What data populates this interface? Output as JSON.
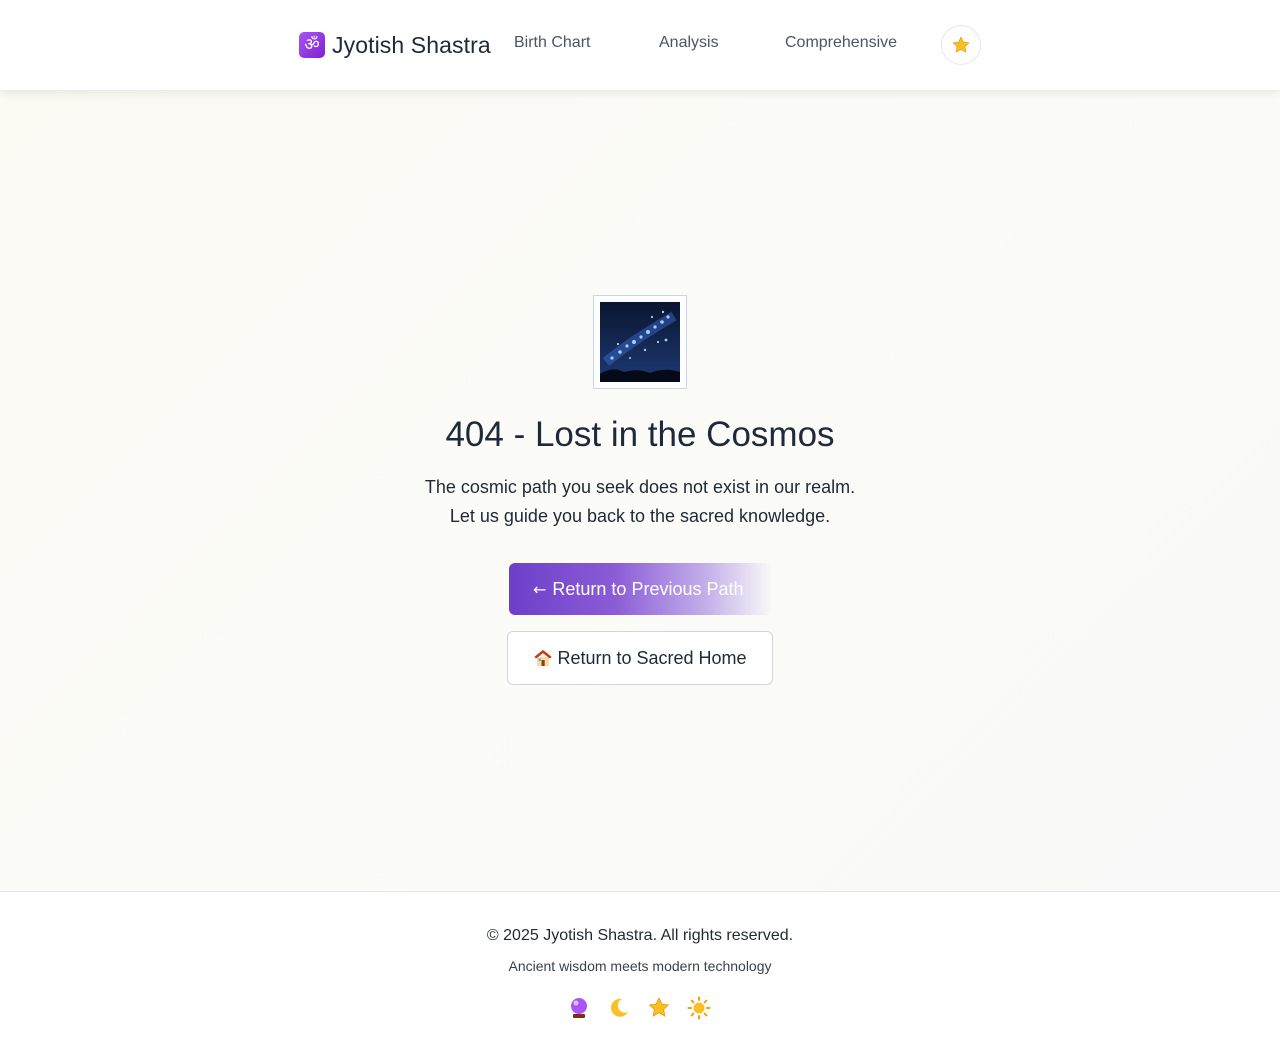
{
  "header": {
    "brand_icon_glyph": "ॐ",
    "brand_name": "Jyotish Shastra",
    "nav": {
      "birth_chart": "Birth Chart",
      "analysis": "Analysis",
      "comprehensive": "Comprehensive"
    },
    "star_icon": "star-icon"
  },
  "main": {
    "hero_icon": "night-sky-icon",
    "title": "404 - Lost in the Cosmos",
    "description_line1": "The cosmic path you seek does not exist in our realm.",
    "description_line2": "Let us guide you back to the sacred knowledge.",
    "return_previous_arrow": "←",
    "return_previous_label": "Return to Previous Path",
    "return_home_label": "Return to Sacred Home"
  },
  "footer": {
    "copyright": "© 2025 Jyotish Shastra. All rights reserved.",
    "tagline": "Ancient wisdom meets modern technology",
    "icons": [
      "crystal-ball-icon",
      "crescent-moon-icon",
      "star-icon",
      "sun-icon"
    ]
  },
  "colors": {
    "accent_purple": "#6d3fc9",
    "star_yellow": "#fbbf24"
  }
}
